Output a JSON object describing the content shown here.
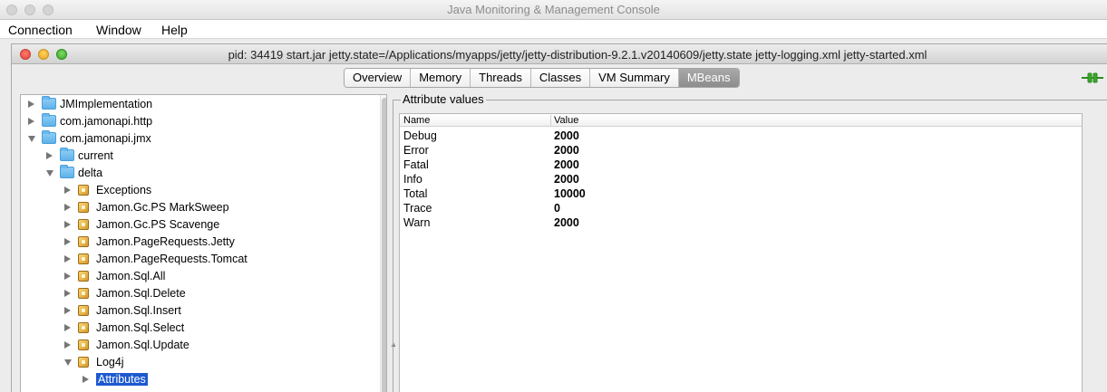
{
  "app": {
    "title": "Java Monitoring & Management Console"
  },
  "menu": [
    "Connection",
    "Window",
    "Help"
  ],
  "window": {
    "title": "pid: 34419 start.jar jetty.state=/Applications/myapps/jetty/jetty-distribution-9.2.1.v20140609/jetty.state jetty-logging.xml jetty-started.xml"
  },
  "tabs": [
    {
      "label": "Overview",
      "selected": false
    },
    {
      "label": "Memory",
      "selected": false
    },
    {
      "label": "Threads",
      "selected": false
    },
    {
      "label": "Classes",
      "selected": false
    },
    {
      "label": "VM Summary",
      "selected": false
    },
    {
      "label": "MBeans",
      "selected": true
    }
  ],
  "tree": [
    {
      "label": "JMImplementation",
      "icon": "folder-icon",
      "expanded": false,
      "depth": 0
    },
    {
      "label": "com.jamonapi.http",
      "icon": "folder-icon",
      "expanded": false,
      "depth": 0
    },
    {
      "label": "com.jamonapi.jmx",
      "icon": "folder-icon",
      "expanded": true,
      "depth": 0
    },
    {
      "label": "current",
      "icon": "folder-icon",
      "expanded": false,
      "depth": 1
    },
    {
      "label": "delta",
      "icon": "folder-icon",
      "expanded": true,
      "depth": 1
    },
    {
      "label": "Exceptions",
      "icon": "mbean-icon",
      "expanded": false,
      "depth": 2
    },
    {
      "label": "Jamon.Gc.PS MarkSweep",
      "icon": "mbean-icon",
      "expanded": false,
      "depth": 2
    },
    {
      "label": "Jamon.Gc.PS Scavenge",
      "icon": "mbean-icon",
      "expanded": false,
      "depth": 2
    },
    {
      "label": "Jamon.PageRequests.Jetty",
      "icon": "mbean-icon",
      "expanded": false,
      "depth": 2
    },
    {
      "label": "Jamon.PageRequests.Tomcat",
      "icon": "mbean-icon",
      "expanded": false,
      "depth": 2
    },
    {
      "label": "Jamon.Sql.All",
      "icon": "mbean-icon",
      "expanded": false,
      "depth": 2
    },
    {
      "label": "Jamon.Sql.Delete",
      "icon": "mbean-icon",
      "expanded": false,
      "depth": 2
    },
    {
      "label": "Jamon.Sql.Insert",
      "icon": "mbean-icon",
      "expanded": false,
      "depth": 2
    },
    {
      "label": "Jamon.Sql.Select",
      "icon": "mbean-icon",
      "expanded": false,
      "depth": 2
    },
    {
      "label": "Jamon.Sql.Update",
      "icon": "mbean-icon",
      "expanded": false,
      "depth": 2
    },
    {
      "label": "Log4j",
      "icon": "mbean-icon",
      "expanded": true,
      "depth": 2
    },
    {
      "label": "Attributes",
      "icon": "",
      "expanded": false,
      "depth": 3,
      "selected": true
    }
  ],
  "attributes": {
    "group_title": "Attribute values",
    "columns": [
      "Name",
      "Value"
    ],
    "rows": [
      {
        "name": "Debug",
        "value": "2000"
      },
      {
        "name": "Error",
        "value": "2000"
      },
      {
        "name": "Fatal",
        "value": "2000"
      },
      {
        "name": "Info",
        "value": "2000"
      },
      {
        "name": "Total",
        "value": "10000"
      },
      {
        "name": "Trace",
        "value": "0"
      },
      {
        "name": "Warn",
        "value": "2000"
      }
    ]
  },
  "colors": {
    "selection": "#1c59d0",
    "selected_tab": "#9a9a9a",
    "folder": "#6bb9ee",
    "connected_icon": "#3aa52a"
  }
}
